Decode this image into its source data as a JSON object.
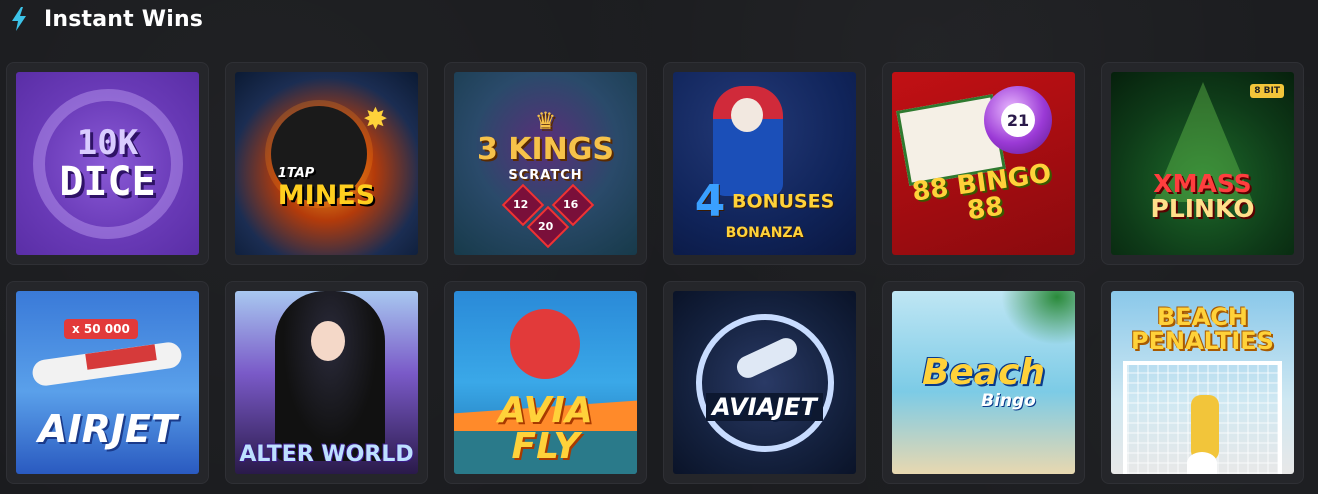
{
  "section": {
    "title": "Instant Wins",
    "icon": "lightning-bolt-icon",
    "accent_color": "#3cc3e8"
  },
  "games": [
    {
      "lines": [
        "10K",
        "DICE"
      ]
    },
    {
      "tag": "1TAP",
      "lines": [
        "MINES"
      ]
    },
    {
      "lines": [
        "3 KINGS"
      ],
      "sub": "SCRATCH",
      "numbers": [
        "12",
        "16",
        "20"
      ]
    },
    {
      "number": "4",
      "lines": [
        "BONUSES"
      ],
      "sub": "BONANZA"
    },
    {
      "ball": "21",
      "lines": [
        "88 BINGO 88"
      ]
    },
    {
      "badge": "8 BIT",
      "lines": [
        "XMASS",
        "PLINKO"
      ]
    },
    {
      "multiplier": "x 50 000",
      "lines": [
        "AIRJET"
      ]
    },
    {
      "lines": [
        "ALTER WORLD"
      ]
    },
    {
      "lines": [
        "AVIA",
        "FLY"
      ]
    },
    {
      "lines": [
        "AVIAJET"
      ]
    },
    {
      "lines": [
        "Beach"
      ],
      "sub": "Bingo"
    },
    {
      "lines": [
        "BEACH",
        "PENALTIES"
      ]
    }
  ]
}
